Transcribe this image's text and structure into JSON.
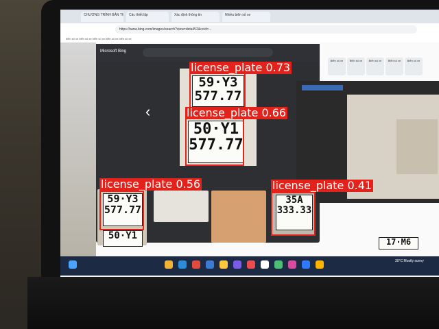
{
  "browser": {
    "tabs": [
      "CHƯƠNG TRÌNH BẢN TIN",
      "Các thiết lập",
      "Xác định thông tin",
      "Nhiều biển số xe"
    ],
    "address": "https://www.bing.com/images/search?view=detailV2&ccid=...",
    "bookmarks": "biển số xe   biển số xe   biển số xe   biển số xe   biển số xe"
  },
  "viewer": {
    "logo": "Microsoft Bing",
    "prev_symbol": "‹",
    "next_symbol": "›"
  },
  "plates": {
    "main_top": [
      "59·Y3",
      "577.77"
    ],
    "main_bottom": [
      "50·Y1",
      "577.77"
    ],
    "thumb1": [
      "59·Y3",
      "577.77"
    ],
    "thumb1_below": "50·Y1",
    "thumb4": [
      "35A",
      "333.33"
    ],
    "bottom_strip": "17·M6"
  },
  "detections": [
    {
      "label": "license_plate 0.73"
    },
    {
      "label": "license_plate 0.66"
    },
    {
      "label": "license_plate 0.56"
    },
    {
      "label": "license_plate 0.41"
    }
  ],
  "ribbon": [
    "Biển số xe",
    "Biển số xe",
    "Biển số xe",
    "Biển số xe",
    "Biển số xe"
  ],
  "taskbar": {
    "clock": "30°C Mostly sunny"
  },
  "colors": {
    "detection": "#e3231b",
    "taskbar": "#1c2a44"
  }
}
